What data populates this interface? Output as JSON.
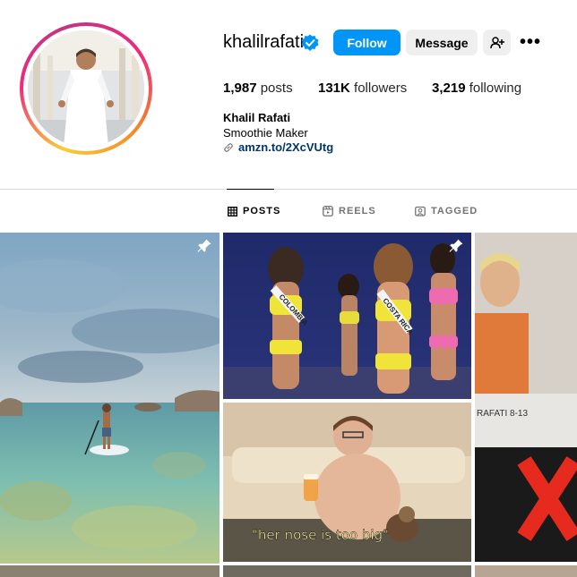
{
  "profile": {
    "username": "khalilrafati",
    "verified": true,
    "follow_label": "Follow",
    "message_label": "Message",
    "more_label": "•••",
    "stats": {
      "posts_count": "1,987",
      "posts_label": "posts",
      "followers_count": "131K",
      "followers_label": "followers",
      "following_count": "3,219",
      "following_label": "following"
    },
    "bio": {
      "name": "Khalil Rafati",
      "description": "Smoothie Maker",
      "link": "amzn.to/2XcVUtg"
    }
  },
  "tabs": [
    {
      "label": "POSTS",
      "active": true
    },
    {
      "label": "REELS",
      "active": false
    },
    {
      "label": "TAGGED",
      "active": false
    }
  ],
  "grid": {
    "tile3_caption": "\"her nose is too big\"",
    "tile2_sash_left": "COLOMBIA",
    "tile2_sash_right": "COSTA RICA",
    "tile4_sign": "RAFATI  8-13"
  },
  "colors": {
    "accent": "#0095f6",
    "link": "#00376b"
  }
}
